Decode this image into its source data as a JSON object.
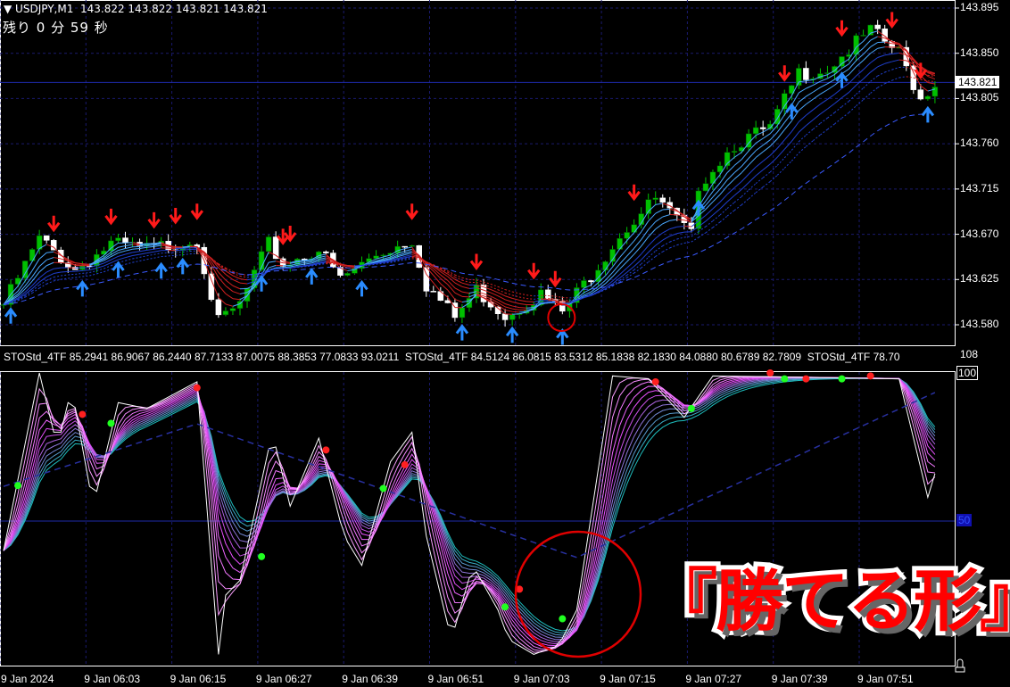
{
  "header": {
    "title": "USDJPY,M1",
    "ohlc": "143.822 143.822 143.821 143.821",
    "menu_icon": "triangle-down-icon"
  },
  "timer": {
    "text": "残り 0 分 59 秒"
  },
  "indicator_label": "STOStd_4TF 85.2941 86.9067 86.2440 87.7133 87.0075 88.3853 77.0833 93.0211  STOStd_4TF 84.5124 86.0815 83.5312 85.1838 82.1830 84.0880 80.6789 82.7809  STOStd_4TF 78.70",
  "annotation": "『勝てる形』",
  "colors": {
    "bull": "#00c000",
    "bear": "#ffffff",
    "grid": "#1a1a6e",
    "up_arrow": "#2a8cff",
    "down_arrow": "#ff1a1a",
    "signal_red": "#ff2020",
    "signal_green": "#20ff20"
  },
  "chart_data": [
    {
      "type": "candlestick",
      "title": "USDJPY,M1",
      "y_ticks": [
        "143.895",
        "143.850",
        "143.805",
        "143.760",
        "143.715",
        "143.670",
        "143.625",
        "143.580"
      ],
      "ylim": [
        143.572,
        143.902
      ],
      "current_price": "143.821",
      "x_ticks": [
        "9 Jan 2024",
        "9 Jan 06:03",
        "9 Jan 06:15",
        "9 Jan 06:27",
        "9 Jan 06:39",
        "9 Jan 06:51",
        "9 Jan 07:03",
        "9 Jan 07:15",
        "9 Jan 07:27",
        "9 Jan 07:39",
        "9 Jan 07:51"
      ],
      "x_tick_minutes": [
        0,
        12,
        24,
        36,
        48,
        60,
        72,
        84,
        96,
        108,
        120
      ],
      "candle_count": 131,
      "price_path": [
        [
          0,
          143.6
        ],
        [
          5,
          143.665
        ],
        [
          10,
          143.635
        ],
        [
          15,
          143.66
        ],
        [
          20,
          143.655
        ],
        [
          27,
          143.665
        ],
        [
          30,
          143.582
        ],
        [
          33,
          143.6
        ],
        [
          37,
          143.66
        ],
        [
          39,
          143.64
        ],
        [
          44,
          143.655
        ],
        [
          47,
          143.625
        ],
        [
          52,
          143.65
        ],
        [
          57,
          143.665
        ],
        [
          59,
          143.62
        ],
        [
          63,
          143.587
        ],
        [
          66,
          143.615
        ],
        [
          70,
          143.59
        ],
        [
          75,
          143.61
        ],
        [
          78,
          143.592
        ],
        [
          82,
          143.63
        ],
        [
          86,
          143.67
        ],
        [
          91,
          143.705
        ],
        [
          96,
          143.668
        ],
        [
          97,
          143.72
        ],
        [
          102,
          143.76
        ],
        [
          107,
          143.775
        ],
        [
          111,
          143.83
        ],
        [
          115,
          143.835
        ],
        [
          121,
          143.872
        ],
        [
          125,
          143.85
        ],
        [
          128,
          143.805
        ],
        [
          130,
          143.821
        ]
      ],
      "down_arrow_minutes": [
        7,
        15,
        21,
        24,
        27,
        39,
        40,
        57,
        66,
        74,
        77,
        88,
        109,
        117,
        124,
        128
      ],
      "up_arrow_minutes": [
        1,
        11,
        16,
        22,
        25,
        36,
        43,
        50,
        64,
        71,
        78,
        97,
        110,
        117,
        129
      ],
      "highlight_minute": 78
    },
    {
      "type": "line",
      "title": "STOStd_4TF",
      "y_ticks": [
        "108",
        "100",
        "50"
      ],
      "ylim": [
        0,
        100
      ],
      "level": 50,
      "stoch_path": [
        [
          0,
          40
        ],
        [
          5,
          100
        ],
        [
          7.5,
          75
        ],
        [
          9.5,
          95
        ],
        [
          12.5,
          55
        ],
        [
          16,
          90
        ],
        [
          20,
          88
        ],
        [
          27,
          97
        ],
        [
          30,
          5
        ],
        [
          31,
          25
        ],
        [
          33,
          30
        ],
        [
          37.5,
          80
        ],
        [
          40,
          55
        ],
        [
          44,
          78
        ],
        [
          47.5,
          45
        ],
        [
          50,
          35
        ],
        [
          54,
          70
        ],
        [
          57,
          80
        ],
        [
          59,
          45
        ],
        [
          62.5,
          10
        ],
        [
          65.5,
          35
        ],
        [
          69,
          20
        ],
        [
          70.5,
          10
        ],
        [
          74,
          5
        ],
        [
          77.5,
          8
        ],
        [
          80,
          20
        ],
        [
          85,
          99
        ],
        [
          90,
          98
        ],
        [
          95,
          85
        ],
        [
          99,
          99
        ],
        [
          125,
          98
        ],
        [
          129,
          58
        ],
        [
          130.5,
          70
        ]
      ],
      "slow_path": [
        [
          0,
          61.7
        ],
        [
          27,
          82.8
        ],
        [
          80,
          37.7
        ],
        [
          130,
          93.4
        ]
      ],
      "red_signals": [
        [
          11,
          86
        ],
        [
          27,
          95
        ],
        [
          45,
          74
        ],
        [
          56,
          69
        ],
        [
          72,
          27
        ],
        [
          91,
          97
        ],
        [
          107,
          100
        ],
        [
          112,
          98
        ],
        [
          121,
          99
        ]
      ],
      "green_signals": [
        [
          2,
          62
        ],
        [
          15,
          83
        ],
        [
          36,
          38
        ],
        [
          53,
          61
        ],
        [
          70,
          21
        ],
        [
          78,
          17
        ],
        [
          96,
          88
        ],
        [
          109,
          98
        ],
        [
          117,
          98
        ]
      ],
      "highlight_minute": 81
    }
  ]
}
